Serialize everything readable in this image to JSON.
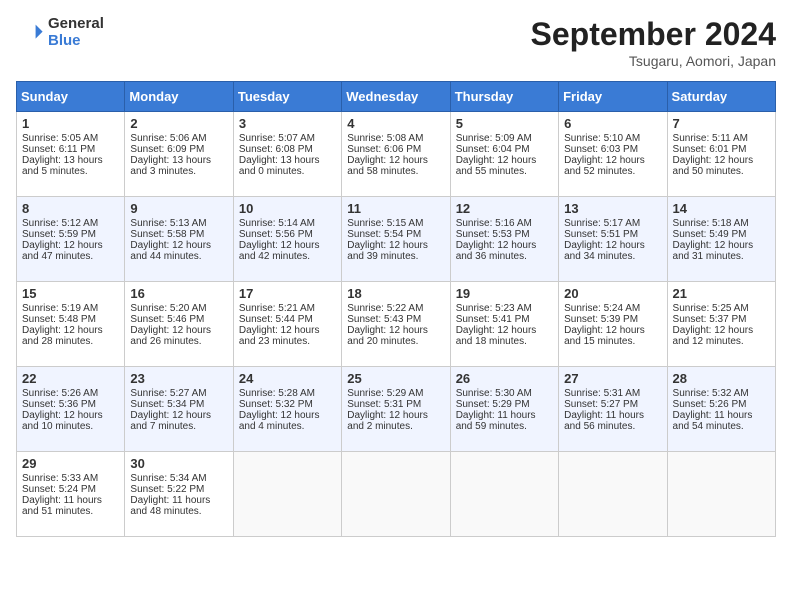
{
  "header": {
    "logo_line1": "General",
    "logo_line2": "Blue",
    "title": "September 2024",
    "subtitle": "Tsugaru, Aomori, Japan"
  },
  "days_of_week": [
    "Sunday",
    "Monday",
    "Tuesday",
    "Wednesday",
    "Thursday",
    "Friday",
    "Saturday"
  ],
  "weeks": [
    [
      {
        "day": "1",
        "lines": [
          "Sunrise: 5:05 AM",
          "Sunset: 6:11 PM",
          "Daylight: 13 hours",
          "and 5 minutes."
        ]
      },
      {
        "day": "2",
        "lines": [
          "Sunrise: 5:06 AM",
          "Sunset: 6:09 PM",
          "Daylight: 13 hours",
          "and 3 minutes."
        ]
      },
      {
        "day": "3",
        "lines": [
          "Sunrise: 5:07 AM",
          "Sunset: 6:08 PM",
          "Daylight: 13 hours",
          "and 0 minutes."
        ]
      },
      {
        "day": "4",
        "lines": [
          "Sunrise: 5:08 AM",
          "Sunset: 6:06 PM",
          "Daylight: 12 hours",
          "and 58 minutes."
        ]
      },
      {
        "day": "5",
        "lines": [
          "Sunrise: 5:09 AM",
          "Sunset: 6:04 PM",
          "Daylight: 12 hours",
          "and 55 minutes."
        ]
      },
      {
        "day": "6",
        "lines": [
          "Sunrise: 5:10 AM",
          "Sunset: 6:03 PM",
          "Daylight: 12 hours",
          "and 52 minutes."
        ]
      },
      {
        "day": "7",
        "lines": [
          "Sunrise: 5:11 AM",
          "Sunset: 6:01 PM",
          "Daylight: 12 hours",
          "and 50 minutes."
        ]
      }
    ],
    [
      {
        "day": "8",
        "lines": [
          "Sunrise: 5:12 AM",
          "Sunset: 5:59 PM",
          "Daylight: 12 hours",
          "and 47 minutes."
        ]
      },
      {
        "day": "9",
        "lines": [
          "Sunrise: 5:13 AM",
          "Sunset: 5:58 PM",
          "Daylight: 12 hours",
          "and 44 minutes."
        ]
      },
      {
        "day": "10",
        "lines": [
          "Sunrise: 5:14 AM",
          "Sunset: 5:56 PM",
          "Daylight: 12 hours",
          "and 42 minutes."
        ]
      },
      {
        "day": "11",
        "lines": [
          "Sunrise: 5:15 AM",
          "Sunset: 5:54 PM",
          "Daylight: 12 hours",
          "and 39 minutes."
        ]
      },
      {
        "day": "12",
        "lines": [
          "Sunrise: 5:16 AM",
          "Sunset: 5:53 PM",
          "Daylight: 12 hours",
          "and 36 minutes."
        ]
      },
      {
        "day": "13",
        "lines": [
          "Sunrise: 5:17 AM",
          "Sunset: 5:51 PM",
          "Daylight: 12 hours",
          "and 34 minutes."
        ]
      },
      {
        "day": "14",
        "lines": [
          "Sunrise: 5:18 AM",
          "Sunset: 5:49 PM",
          "Daylight: 12 hours",
          "and 31 minutes."
        ]
      }
    ],
    [
      {
        "day": "15",
        "lines": [
          "Sunrise: 5:19 AM",
          "Sunset: 5:48 PM",
          "Daylight: 12 hours",
          "and 28 minutes."
        ]
      },
      {
        "day": "16",
        "lines": [
          "Sunrise: 5:20 AM",
          "Sunset: 5:46 PM",
          "Daylight: 12 hours",
          "and 26 minutes."
        ]
      },
      {
        "day": "17",
        "lines": [
          "Sunrise: 5:21 AM",
          "Sunset: 5:44 PM",
          "Daylight: 12 hours",
          "and 23 minutes."
        ]
      },
      {
        "day": "18",
        "lines": [
          "Sunrise: 5:22 AM",
          "Sunset: 5:43 PM",
          "Daylight: 12 hours",
          "and 20 minutes."
        ]
      },
      {
        "day": "19",
        "lines": [
          "Sunrise: 5:23 AM",
          "Sunset: 5:41 PM",
          "Daylight: 12 hours",
          "and 18 minutes."
        ]
      },
      {
        "day": "20",
        "lines": [
          "Sunrise: 5:24 AM",
          "Sunset: 5:39 PM",
          "Daylight: 12 hours",
          "and 15 minutes."
        ]
      },
      {
        "day": "21",
        "lines": [
          "Sunrise: 5:25 AM",
          "Sunset: 5:37 PM",
          "Daylight: 12 hours",
          "and 12 minutes."
        ]
      }
    ],
    [
      {
        "day": "22",
        "lines": [
          "Sunrise: 5:26 AM",
          "Sunset: 5:36 PM",
          "Daylight: 12 hours",
          "and 10 minutes."
        ]
      },
      {
        "day": "23",
        "lines": [
          "Sunrise: 5:27 AM",
          "Sunset: 5:34 PM",
          "Daylight: 12 hours",
          "and 7 minutes."
        ]
      },
      {
        "day": "24",
        "lines": [
          "Sunrise: 5:28 AM",
          "Sunset: 5:32 PM",
          "Daylight: 12 hours",
          "and 4 minutes."
        ]
      },
      {
        "day": "25",
        "lines": [
          "Sunrise: 5:29 AM",
          "Sunset: 5:31 PM",
          "Daylight: 12 hours",
          "and 2 minutes."
        ]
      },
      {
        "day": "26",
        "lines": [
          "Sunrise: 5:30 AM",
          "Sunset: 5:29 PM",
          "Daylight: 11 hours",
          "and 59 minutes."
        ]
      },
      {
        "day": "27",
        "lines": [
          "Sunrise: 5:31 AM",
          "Sunset: 5:27 PM",
          "Daylight: 11 hours",
          "and 56 minutes."
        ]
      },
      {
        "day": "28",
        "lines": [
          "Sunrise: 5:32 AM",
          "Sunset: 5:26 PM",
          "Daylight: 11 hours",
          "and 54 minutes."
        ]
      }
    ],
    [
      {
        "day": "29",
        "lines": [
          "Sunrise: 5:33 AM",
          "Sunset: 5:24 PM",
          "Daylight: 11 hours",
          "and 51 minutes."
        ]
      },
      {
        "day": "30",
        "lines": [
          "Sunrise: 5:34 AM",
          "Sunset: 5:22 PM",
          "Daylight: 11 hours",
          "and 48 minutes."
        ]
      },
      {
        "day": "",
        "lines": []
      },
      {
        "day": "",
        "lines": []
      },
      {
        "day": "",
        "lines": []
      },
      {
        "day": "",
        "lines": []
      },
      {
        "day": "",
        "lines": []
      }
    ]
  ]
}
